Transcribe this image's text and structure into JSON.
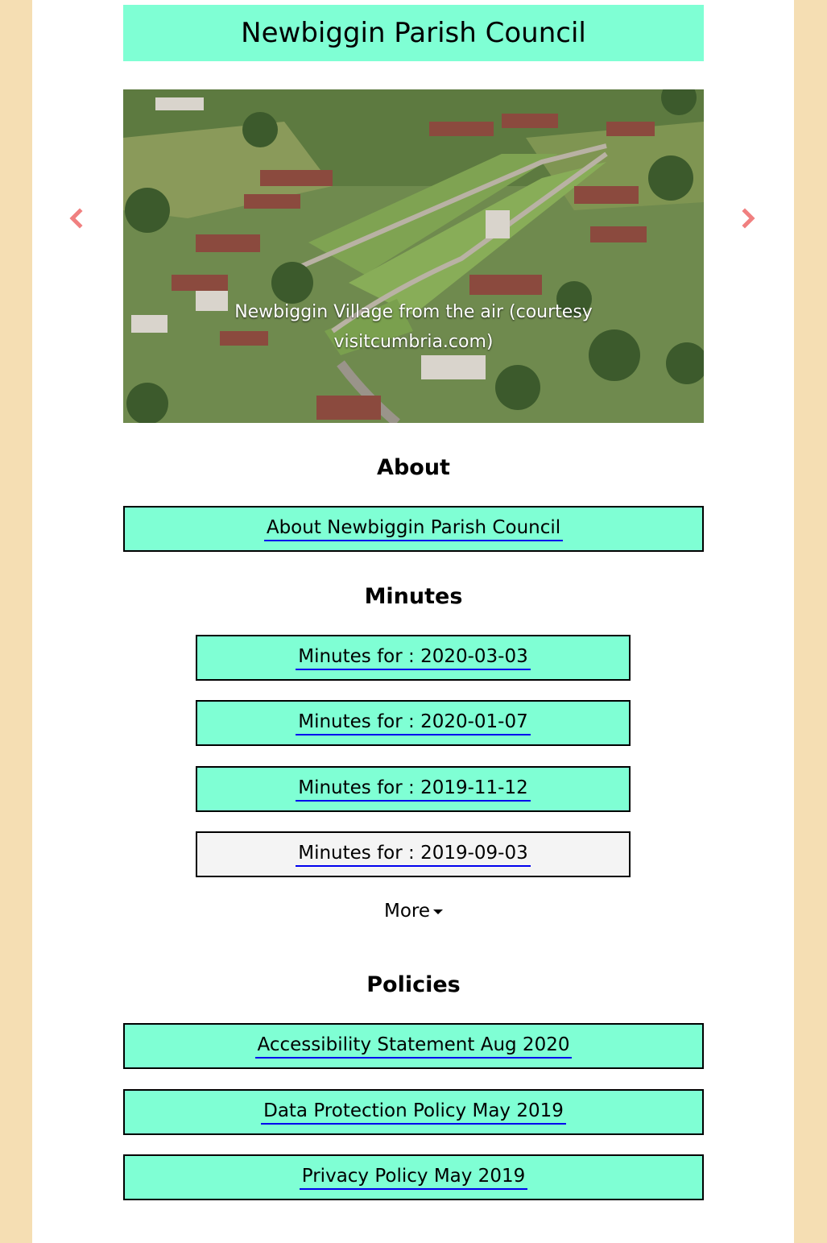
{
  "site": {
    "title": "Newbiggin Parish Council"
  },
  "carousel": {
    "caption": "Newbiggin Village from the air (courtesy visitcumbria.com)",
    "prev_icon": "chevron-left-icon",
    "next_icon": "chevron-right-icon"
  },
  "about": {
    "heading": "About",
    "links": [
      {
        "label": "About Newbiggin Parish Council"
      }
    ]
  },
  "minutes": {
    "heading": "Minutes",
    "items": [
      {
        "label": "Minutes for : 2020-03-03"
      },
      {
        "label": "Minutes for : 2020-01-07"
      },
      {
        "label": "Minutes for : 2019-11-12"
      },
      {
        "label": "Minutes for : 2019-09-03"
      }
    ],
    "more_label": "More"
  },
  "policies": {
    "heading": "Policies",
    "items": [
      {
        "label": "Accessibility Statement Aug 2020"
      },
      {
        "label": "Data Protection Policy May 2019"
      },
      {
        "label": "Privacy Policy May 2019"
      }
    ]
  },
  "colors": {
    "background": "#f5deb3",
    "accent": "#7fffd4",
    "hover": "#f4f4f4",
    "link_underline": "#0000ee",
    "arrow": "#f08080"
  }
}
